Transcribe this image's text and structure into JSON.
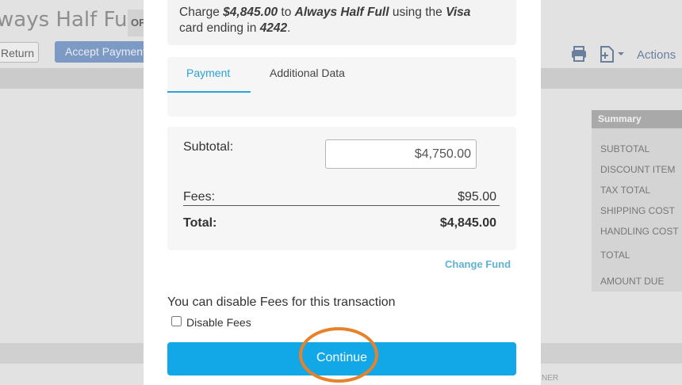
{
  "background": {
    "title": "ways Half Full",
    "badge": "OF",
    "return_label": "Return",
    "accept_payment_label": "Accept Payment",
    "actions_label": "Actions",
    "summary": {
      "header": "Summary",
      "rows": [
        "SUBTOTAL",
        "DISCOUNT ITEM",
        "TAX TOTAL",
        "SHIPPING COST",
        "HANDLING COST",
        "TOTAL",
        "AMOUNT DUE"
      ]
    },
    "footer_text": "NER"
  },
  "modal": {
    "charge": {
      "prefix": "Charge ",
      "amount": "$4,845.00",
      "to": " to ",
      "customer": "Always Half Full",
      "using": " using the ",
      "card_brand": "Visa",
      "card_text": "card ending in ",
      "card_last4": "4242",
      "period": "."
    },
    "tabs": [
      {
        "label": "Payment",
        "active": true
      },
      {
        "label": "Additional Data",
        "active": false
      }
    ],
    "totals": {
      "subtotal_label": "Subtotal:",
      "subtotal_value": "$4,750.00",
      "fees_label": "Fees:",
      "fees_value": "$95.00",
      "total_label": "Total:",
      "total_value": "$4,845.00"
    },
    "change_fund_label": "Change Fund",
    "disable_note": "You can disable Fees for this transaction",
    "disable_fees_label": "Disable Fees",
    "disable_fees_checked": false,
    "continue_label": "Continue"
  },
  "colors": {
    "accent": "#12a8e8",
    "tab_active": "#2aa3d6",
    "link": "#5fb3d2",
    "highlight": "#e8822a"
  }
}
